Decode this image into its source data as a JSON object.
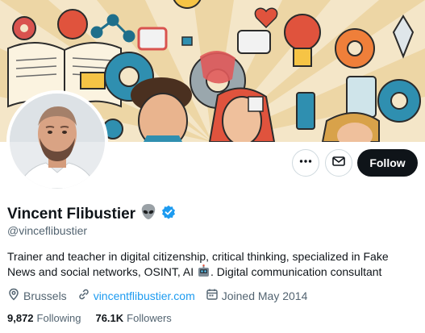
{
  "profile": {
    "display_name": "Vincent Flibustier",
    "handle": "@vinceflibustier",
    "bio_part1": "Trainer and teacher in digital citizenship, critical thinking, specialized in Fake News and social networks, OSINT, AI ",
    "bio_part2": ". Digital communication consultant",
    "location": "Brussels",
    "website": "vincentflibustier.com",
    "joined": "Joined May 2014",
    "following_count": "9,872",
    "following_label": "Following",
    "followers_count": "76.1K",
    "followers_label": "Followers"
  },
  "actions": {
    "follow_label": "Follow"
  },
  "icons": {
    "more": "more-icon",
    "message": "mail-icon",
    "verified": "verified-badge-icon",
    "location": "location-pin-icon",
    "link": "link-icon",
    "calendar": "calendar-icon"
  },
  "colors": {
    "accent": "#1d9bf0",
    "text": "#0f1419",
    "secondary": "#536471",
    "follow_bg": "#0f1419"
  }
}
